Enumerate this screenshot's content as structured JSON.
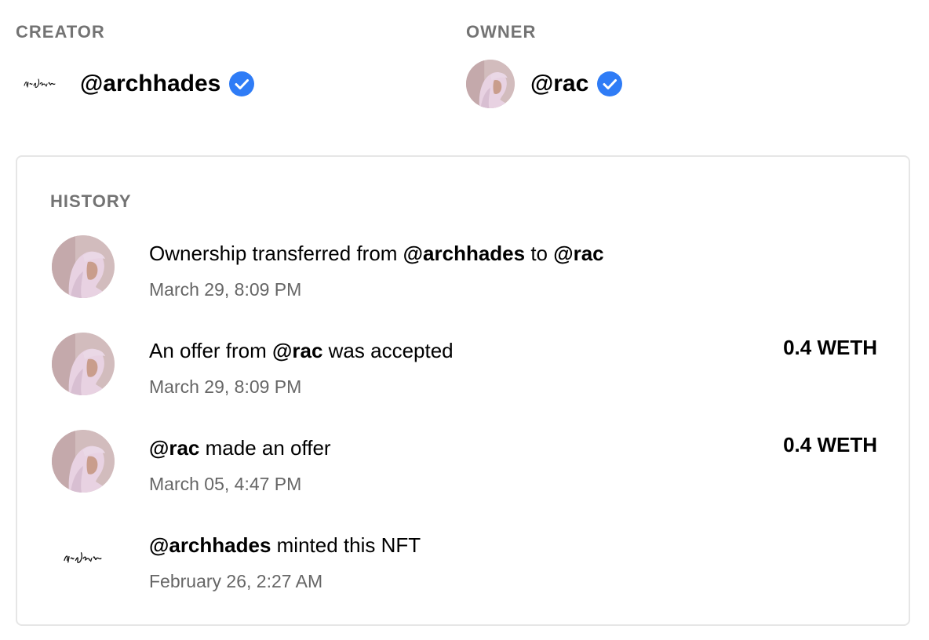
{
  "creator": {
    "label": "CREATOR",
    "handle": "@archhades",
    "signature": "Kiln Hades"
  },
  "owner": {
    "label": "OWNER",
    "handle": "@rac"
  },
  "history": {
    "label": "HISTORY",
    "events": [
      {
        "avatar": "photo",
        "prefix": "Ownership transferred from ",
        "from": "@archhades",
        "mid": " to ",
        "to": "@rac",
        "time": "March 29, 8:09 PM",
        "amount": ""
      },
      {
        "avatar": "photo",
        "prefix": "An offer from ",
        "user": "@rac",
        "suffix": " was accepted",
        "time": "March 29, 8:09 PM",
        "amount": "0.4 WETH"
      },
      {
        "avatar": "photo",
        "user": "@rac",
        "suffix": " made an offer",
        "time": "March 05, 4:47 PM",
        "amount": "0.4 WETH"
      },
      {
        "avatar": "signature",
        "user": "@archhades",
        "suffix": " minted this NFT",
        "time": "February 26, 2:27 AM",
        "amount": ""
      }
    ]
  },
  "colors": {
    "verified": "#2f7cf6",
    "label": "#737373",
    "muted": "#666666",
    "border": "#e6e6e6"
  },
  "icons": {
    "verified": "verified-check-icon"
  }
}
